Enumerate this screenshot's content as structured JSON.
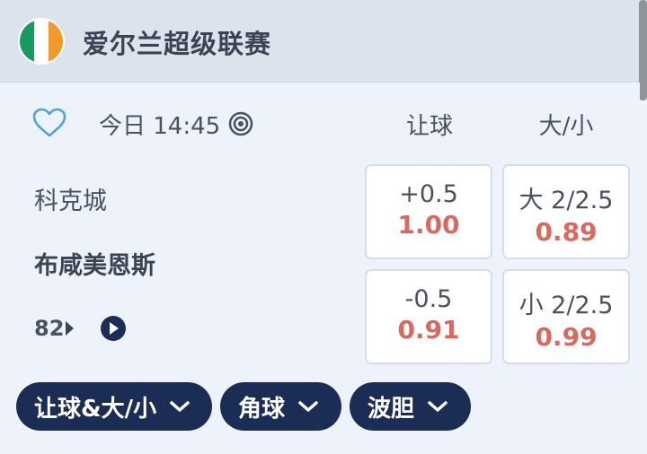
{
  "header": {
    "league_title": "爱尔兰超级联赛",
    "flag_colors": [
      "#169b62",
      "#ffffff",
      "#f39a2c"
    ]
  },
  "match": {
    "time": "今日 14:45",
    "home_team": "科克城",
    "away_team": "布咸美恩斯",
    "minute": "82",
    "columns": {
      "handicap": "让球",
      "over_under": "大/小"
    },
    "odds": {
      "home_handicap": {
        "line": "+0.5",
        "price": "1.00"
      },
      "away_handicap": {
        "line": "-0.5",
        "price": "0.91"
      },
      "over": {
        "line": "大 2/2.5",
        "price": "0.89"
      },
      "under": {
        "line": "小 2/2.5",
        "price": "0.99"
      }
    }
  },
  "filters": [
    {
      "label": "让球&大/小"
    },
    {
      "label": "角球"
    },
    {
      "label": "波胆"
    }
  ],
  "colors": {
    "accent_navy": "#1c2d55",
    "odds_red": "#d9695e",
    "heart_blue": "#4aa3d9"
  }
}
